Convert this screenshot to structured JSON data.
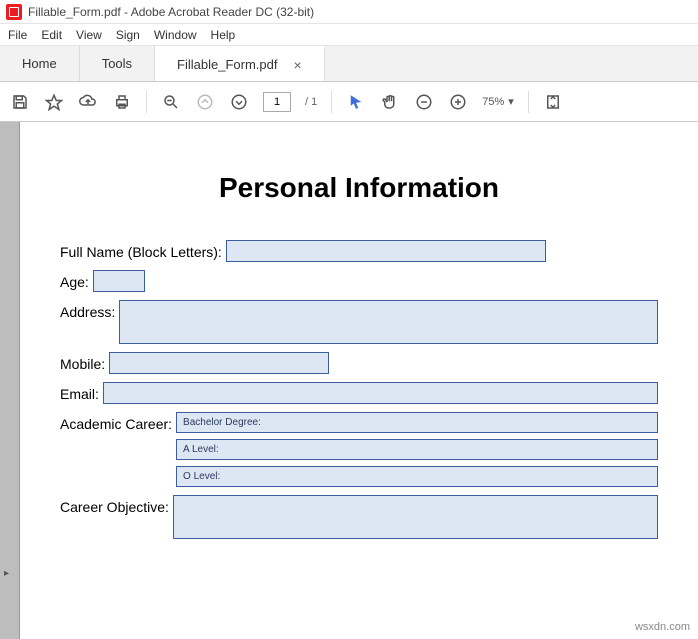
{
  "titlebar": {
    "title": "Fillable_Form.pdf - Adobe Acrobat Reader DC (32-bit)"
  },
  "menu": {
    "file": "File",
    "edit": "Edit",
    "view": "View",
    "sign": "Sign",
    "window": "Window",
    "help": "Help"
  },
  "tabs": {
    "home": "Home",
    "tools": "Tools",
    "doc": "Fillable_Form.pdf"
  },
  "toolbar": {
    "page_current": "1",
    "page_total": "/ 1",
    "zoom": "75%"
  },
  "form": {
    "heading": "Personal Information",
    "full_name_label": "Full Name (Block Letters):",
    "age_label": "Age:",
    "address_label": "Address:",
    "mobile_label": "Mobile:",
    "email_label": "Email:",
    "academic_career_label": "Academic Career:",
    "academic": {
      "bachelor": "Bachelor Degree:",
      "alevel": "A Level:",
      "olevel": "O Level:"
    },
    "career_objective_label": "Career Objective:"
  },
  "watermark": "wsxdn.com"
}
